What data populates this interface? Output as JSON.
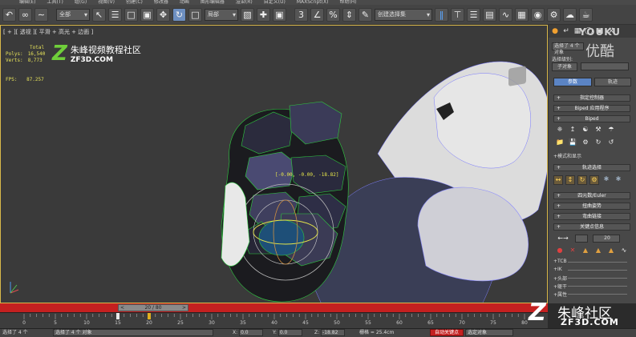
{
  "menubar": {
    "items": [
      "编辑(E)",
      "工具(T)",
      "组(G)",
      "视图(V)",
      "创建(C)",
      "修改器",
      "动画",
      "图形编辑器",
      "渲染(R)",
      "自定义(U)",
      "MAXScript(X)",
      "帮助(H)"
    ]
  },
  "toolbar": {
    "selection_set": "全部",
    "ref_coord": "局部",
    "named_selection": "创建选择集",
    "icons": [
      "undo-icon",
      "redo-icon",
      "link-icon",
      "unlink-icon",
      "bind-icon",
      "select-icon",
      "select-by-name-icon",
      "region-select-icon",
      "window-crossing-icon",
      "move-icon",
      "rotate-icon",
      "scale-icon",
      "pivot-icon",
      "snap-icon",
      "angle-snap-icon",
      "percent-snap-icon",
      "spinner-snap-icon",
      "mirror-icon",
      "align-icon",
      "layer-icon",
      "curve-editor-icon",
      "schematic-icon",
      "material-editor-icon",
      "render-setup-icon",
      "render-frame-icon",
      "render-icon"
    ]
  },
  "viewport": {
    "label": "[ + ][ 透视 ][ 平滑 + 高光 + 边面 ]",
    "stats": [
      {
        "label": "",
        "value": "Total"
      },
      {
        "label": "Polys:",
        "value": "16,540"
      },
      {
        "label": "Verts:",
        "value": "8,773"
      }
    ],
    "fps_label": "FPS:",
    "fps_value": "87.257",
    "coord_readout": "[-0.00, -0.00, -18.82]",
    "watermark_cn": "朱峰视频教程社区",
    "watermark_en": "ZF3D.COM",
    "watermark_z": "Z"
  },
  "command_panel": {
    "watermark_top": "YOUKU",
    "watermark_cn": "优酷",
    "selection_label": "选择了 4 个对象",
    "selection_level_label": "选择级别:",
    "sub_object": "子对象",
    "tab_params": "参数",
    "tab_track": "轨迹",
    "rollouts": {
      "assign_controller": "指定控制器",
      "biped_app": "Biped 应用程序",
      "biped": "Biped",
      "mode_display": "模式和显示",
      "track_select": "轨迹选择",
      "quaternion": "四元数/Euler",
      "twist_pose": "扭曲姿势",
      "bend_links": "弯曲链接",
      "key_info": "关键点信息"
    },
    "key_frame_value": "20",
    "key_sections": [
      "TCB",
      "IK",
      "头部",
      "躯干",
      "属性"
    ]
  },
  "timeline": {
    "slider_text": "20 / 80",
    "slider_left": "<",
    "slider_right": ">",
    "ticks": [
      0,
      5,
      10,
      15,
      20,
      25,
      30,
      35,
      40,
      45,
      50,
      55,
      60,
      65,
      70,
      75,
      80
    ],
    "current_frame": 20,
    "total_frames": 80,
    "key_frames": [
      15
    ]
  },
  "statusbar": {
    "left_text": "选择了 4 个",
    "selection_text": "选择了 4 个 对象",
    "x_label": "X:",
    "x_value": "0.0",
    "y_label": "Y:",
    "y_value": "0.0",
    "z_label": "Z:",
    "z_value": "-18.82",
    "grid_text": "栅格 = 25.4cm",
    "autokey": "自动关键点",
    "key_select": "选定对象"
  },
  "logo_br": {
    "z": "Z",
    "cn": "朱峰社区",
    "en": "ZF3D.COM"
  },
  "colors": {
    "timebar": "#c42020",
    "accent_blue": "#5b84c4",
    "viewport_border": "#d9b84a",
    "stats_yellow": "#e6e25a"
  }
}
